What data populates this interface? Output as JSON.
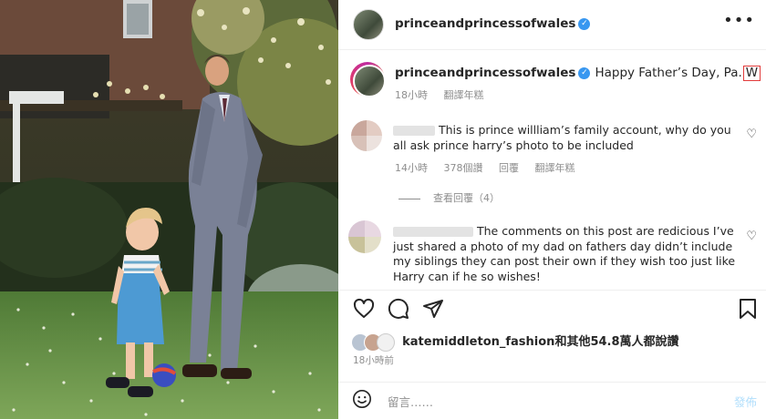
{
  "post": {
    "username": "princeandprincessofwales",
    "more_icon": "more-dots-icon"
  },
  "caption": {
    "username": "princeandprincessofwales",
    "text": "Happy Father’s Day, Pa.",
    "highlight": "W",
    "time": "18小時",
    "translate": "翻譯年糕"
  },
  "comments": [
    {
      "text": "This is prince willliam’s family account, why do you all ask prince harry’s photo to be included",
      "time": "14小時",
      "likes": "378個讚",
      "reply": "回覆",
      "translate": "翻譯年糕",
      "view_replies": "查看回覆（4）"
    },
    {
      "text": "The comments on this post are redicious I’ve just shared a photo of my dad on fathers day didn’t include my siblings they can post their own if they wish too just like Harry can if he so wishes!"
    }
  ],
  "likes": {
    "text": "katemiddleton_fashion和其他54.8萬人都說讚"
  },
  "timestamp": "18小時前",
  "comment_input": {
    "placeholder": "留言……",
    "post_label": "發佈"
  },
  "colors": {
    "verified": "#3897f0",
    "highlight_box": "#e23b3b",
    "muted": "#8e8e8e",
    "post_button": "#b2dffc"
  }
}
